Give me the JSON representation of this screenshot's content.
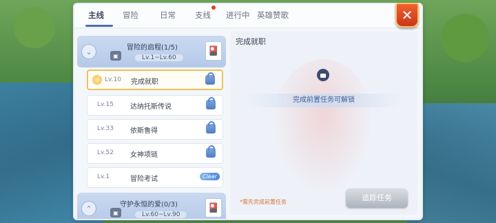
{
  "tabs": [
    {
      "label": "主线"
    },
    {
      "label": "冒险"
    },
    {
      "label": "日常"
    },
    {
      "label": "支线"
    },
    {
      "label": "进行中"
    },
    {
      "label": "英雄赞歌"
    }
  ],
  "chapters": [
    {
      "title": "冒险的启程(1/5)",
      "level": "Lv.1~Lv.60"
    },
    {
      "title": "守护永恒的爱(0/3)",
      "level": "Lv.60~Lv.90"
    }
  ],
  "quests": [
    {
      "level": "Lv.10",
      "name": "完成就职",
      "state": "selected"
    },
    {
      "level": "Lv.15",
      "name": "达纳托斯传说",
      "state": "locked"
    },
    {
      "level": "Lv.33",
      "name": "依斯鲁得",
      "state": "locked"
    },
    {
      "level": "Lv.52",
      "name": "女神项链",
      "state": "locked"
    },
    {
      "level": "Lv.1",
      "name": "冒险考试",
      "state": "clear",
      "badge": "Clear"
    }
  ],
  "detail": {
    "title": "完成就职",
    "unlock_text": "完成前置任务可解锁",
    "requirement": "*需先完成前置任务",
    "track_button": "追踪任务"
  },
  "colors": {
    "accent": "#4a6db0",
    "close": "#e0481f",
    "highlight": "#f0c15a"
  }
}
